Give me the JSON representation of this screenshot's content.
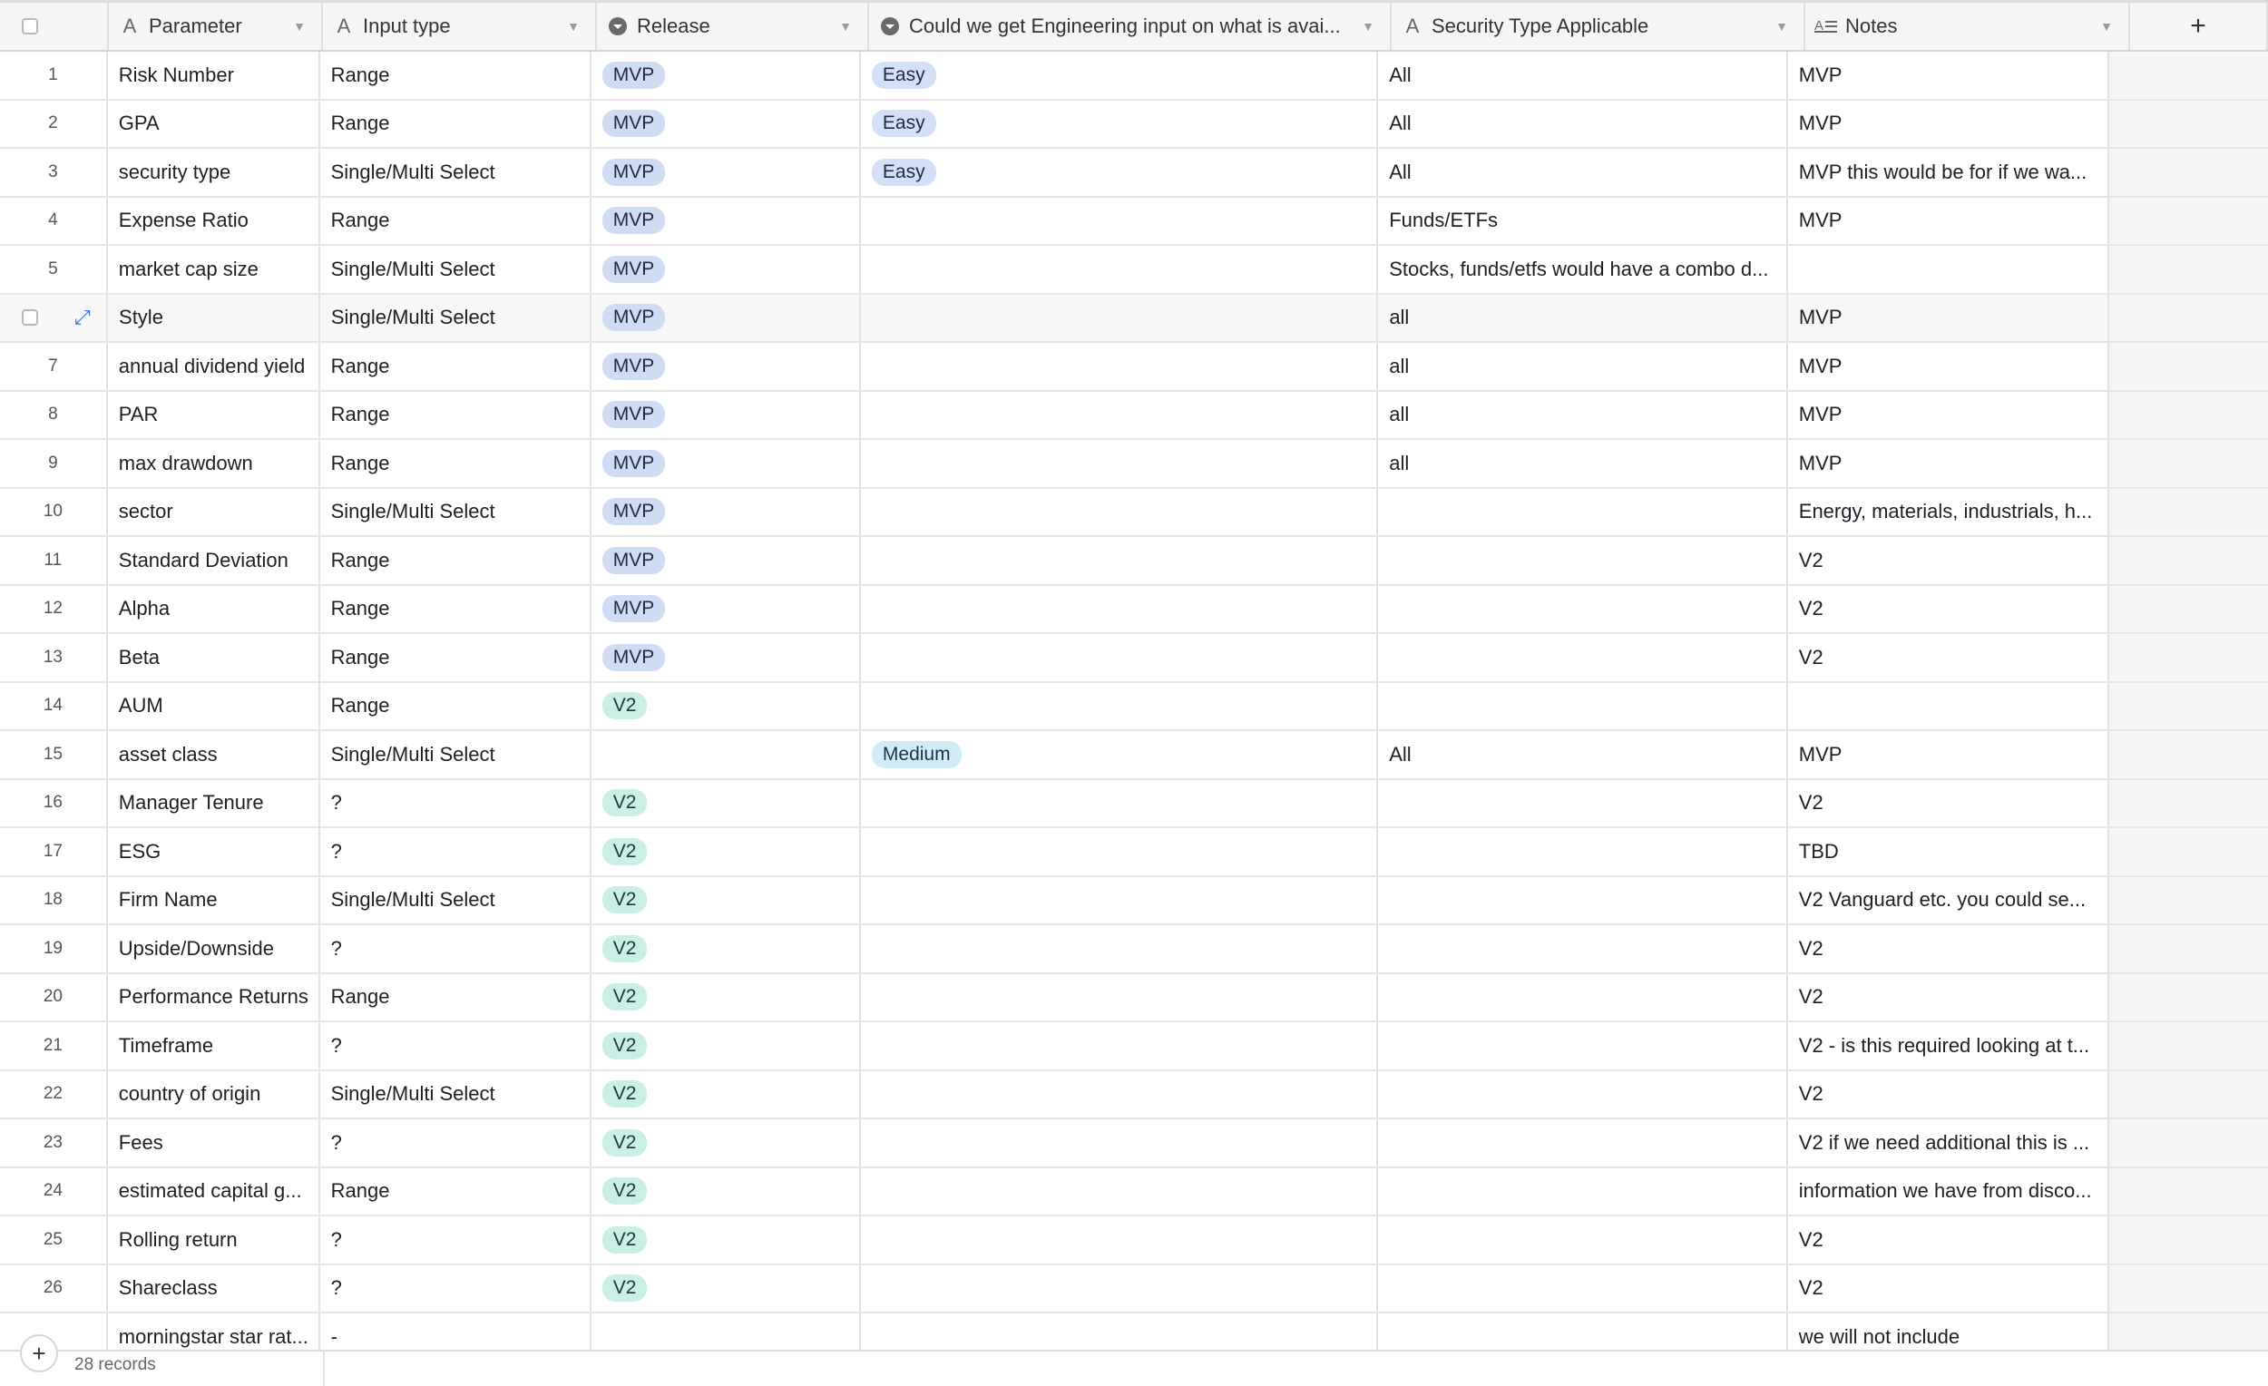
{
  "header": {
    "add_label": "+",
    "columns": [
      {
        "label": "Parameter",
        "icon": "text-field-icon"
      },
      {
        "label": "Input type",
        "icon": "text-field-icon"
      },
      {
        "label": "Release",
        "icon": "single-select-icon"
      },
      {
        "label": "Could we get Engineering input on what is avai...",
        "icon": "single-select-icon"
      },
      {
        "label": "Security Type Applicable",
        "icon": "text-field-icon"
      },
      {
        "label": "Notes",
        "icon": "long-text-icon"
      }
    ]
  },
  "colors": {
    "mvp_pill": "#d0dcf4",
    "v2_pill": "#c9efe6",
    "easy_pill": "#d3e0f7",
    "medium_pill": "#d2ecf7",
    "expand_icon": "#2e6fe0"
  },
  "rows": [
    {
      "num": "1",
      "param": "Risk Number",
      "input": "Range",
      "release": "MVP",
      "eng": "Easy",
      "sec": "All",
      "notes": "MVP"
    },
    {
      "num": "2",
      "param": "GPA",
      "input": "Range",
      "release": "MVP",
      "eng": "Easy",
      "sec": "All",
      "notes": "MVP"
    },
    {
      "num": "3",
      "param": "security type",
      "input": "Single/Multi Select",
      "release": "MVP",
      "eng": "Easy",
      "sec": "All",
      "notes": "MVP this would be for if we wa..."
    },
    {
      "num": "4",
      "param": "Expense Ratio",
      "input": "Range",
      "release": "MVP",
      "eng": "",
      "sec": "Funds/ETFs",
      "notes": "MVP"
    },
    {
      "num": "5",
      "param": "market cap size",
      "input": "Single/Multi Select",
      "release": "MVP",
      "eng": "",
      "sec": "Stocks, funds/etfs would have a combo d...",
      "notes": ""
    },
    {
      "num": "",
      "param": "Style",
      "input": "Single/Multi Select",
      "release": "MVP",
      "eng": "",
      "sec": "all",
      "notes": "MVP",
      "hover": true
    },
    {
      "num": "7",
      "param": "annual dividend yield",
      "input": "Range",
      "release": "MVP",
      "eng": "",
      "sec": "all",
      "notes": "MVP"
    },
    {
      "num": "8",
      "param": "PAR",
      "input": "Range",
      "release": "MVP",
      "eng": "",
      "sec": "all",
      "notes": "MVP"
    },
    {
      "num": "9",
      "param": "max drawdown",
      "input": "Range",
      "release": "MVP",
      "eng": "",
      "sec": "all",
      "notes": "MVP"
    },
    {
      "num": "10",
      "param": "sector",
      "input": "Single/Multi Select",
      "release": "MVP",
      "eng": "",
      "sec": "",
      "notes": "Energy, materials, industrials, h..."
    },
    {
      "num": "11",
      "param": "Standard Deviation",
      "input": "Range",
      "release": "MVP",
      "eng": "",
      "sec": "",
      "notes": "V2"
    },
    {
      "num": "12",
      "param": "Alpha",
      "input": "Range",
      "release": "MVP",
      "eng": "",
      "sec": "",
      "notes": "V2"
    },
    {
      "num": "13",
      "param": "Beta",
      "input": "Range",
      "release": "MVP",
      "eng": "",
      "sec": "",
      "notes": "V2"
    },
    {
      "num": "14",
      "param": "AUM",
      "input": "Range",
      "release": "V2",
      "eng": "",
      "sec": "",
      "notes": ""
    },
    {
      "num": "15",
      "param": "asset class",
      "input": "Single/Multi Select",
      "release": "",
      "eng": "Medium",
      "sec": "All",
      "notes": "MVP"
    },
    {
      "num": "16",
      "param": "Manager Tenure",
      "input": "?",
      "release": "V2",
      "eng": "",
      "sec": "",
      "notes": "V2"
    },
    {
      "num": "17",
      "param": "ESG",
      "input": "?",
      "release": "V2",
      "eng": "",
      "sec": "",
      "notes": "TBD"
    },
    {
      "num": "18",
      "param": "Firm Name",
      "input": "Single/Multi Select",
      "release": "V2",
      "eng": "",
      "sec": "",
      "notes": "V2 Vanguard etc. you could se..."
    },
    {
      "num": "19",
      "param": "Upside/Downside",
      "input": "?",
      "release": "V2",
      "eng": "",
      "sec": "",
      "notes": "V2"
    },
    {
      "num": "20",
      "param": "Performance Returns",
      "input": "Range",
      "release": "V2",
      "eng": "",
      "sec": "",
      "notes": "V2"
    },
    {
      "num": "21",
      "param": "Timeframe",
      "input": "?",
      "release": "V2",
      "eng": "",
      "sec": "",
      "notes": "V2 - is this required looking at t..."
    },
    {
      "num": "22",
      "param": "country of origin",
      "input": "Single/Multi Select",
      "release": "V2",
      "eng": "",
      "sec": "",
      "notes": "V2"
    },
    {
      "num": "23",
      "param": "Fees",
      "input": "?",
      "release": "V2",
      "eng": "",
      "sec": "",
      "notes": "V2 if we need additional this is ..."
    },
    {
      "num": "24",
      "param": "estimated capital g...",
      "input": "Range",
      "release": "V2",
      "eng": "",
      "sec": "",
      "notes": "information we have from disco..."
    },
    {
      "num": "25",
      "param": "Rolling return",
      "input": "?",
      "release": "V2",
      "eng": "",
      "sec": "",
      "notes": "V2"
    },
    {
      "num": "26",
      "param": "Shareclass",
      "input": "?",
      "release": "V2",
      "eng": "",
      "sec": "",
      "notes": "V2"
    },
    {
      "num": "",
      "param": "morningstar star rat...",
      "input": "-",
      "release": "",
      "eng": "",
      "sec": "",
      "notes": "we will not include"
    }
  ],
  "footer": {
    "add_label": "+",
    "count": "28 records"
  }
}
